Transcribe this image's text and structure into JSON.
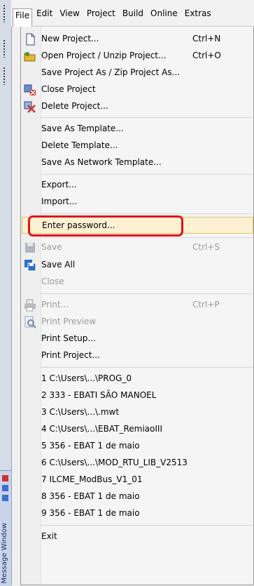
{
  "menubar": {
    "items": [
      "File",
      "Edit",
      "View",
      "Project",
      "Build",
      "Online",
      "Extras"
    ]
  },
  "sidebar": {
    "message_window_label": "Message Window"
  },
  "file_menu": {
    "new_project": {
      "label": "New Project...",
      "shortcut": "Ctrl+N"
    },
    "open_project": {
      "label": "Open Project / Unzip Project...",
      "shortcut": "Ctrl+O"
    },
    "save_project_as": {
      "label": "Save Project As / Zip Project As..."
    },
    "close_project": {
      "label": "Close Project"
    },
    "delete_project": {
      "label": "Delete Project..."
    },
    "save_as_template": {
      "label": "Save As Template..."
    },
    "delete_template": {
      "label": "Delete Template..."
    },
    "save_as_network_template": {
      "label": "Save As Network Template..."
    },
    "export": {
      "label": "Export..."
    },
    "import": {
      "label": "Import..."
    },
    "enter_password": {
      "label": "Enter password..."
    },
    "save": {
      "label": "Save",
      "shortcut": "Ctrl+S"
    },
    "save_all": {
      "label": "Save All"
    },
    "close": {
      "label": "Close"
    },
    "print": {
      "label": "Print...",
      "shortcut": "Ctrl+P"
    },
    "print_preview": {
      "label": "Print Preview"
    },
    "print_setup": {
      "label": "Print Setup..."
    },
    "print_project": {
      "label": "Print Project..."
    },
    "recent": [
      "1 C:\\Users\\...\\PROG_0",
      "2 333 - EBATI SÃO MANOEL",
      "3 C:\\Users\\...\\.mwt",
      "4 C:\\Users\\...\\EBAT_RemiaoIII",
      "5 356 - EBAT 1 de maio",
      "6 C:\\Users\\...\\MOD_RTU_LIB_V2513",
      "7 ILCME_ModBus_V1_01",
      "8 356 - EBAT 1 de maio",
      "9 356 - EBAT 1 de maio"
    ],
    "exit": {
      "label": "Exit"
    }
  },
  "colors": {
    "highlight": "#fcf1d3",
    "annotation": "#e0141b"
  }
}
